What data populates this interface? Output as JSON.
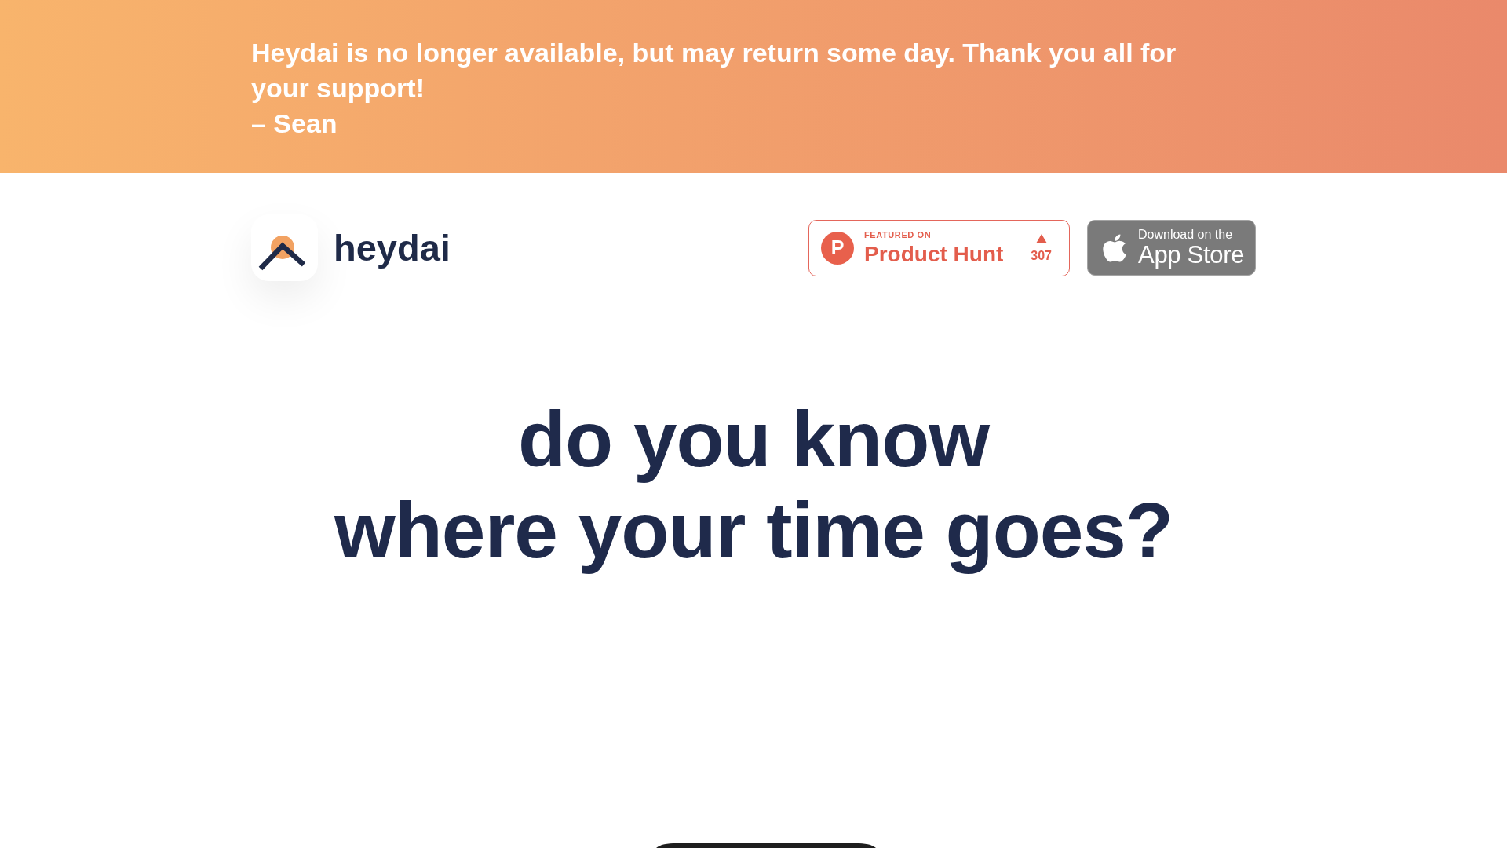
{
  "banner": {
    "message": "Heydai is no longer available, but may return some day. Thank you all for your support!",
    "signature": "– Sean"
  },
  "header": {
    "brand": "heydai",
    "badges": [
      {
        "kind": "product_hunt",
        "logo_letter": "P",
        "caption": "FEATURED ON",
        "title": "Product Hunt",
        "count": "307"
      },
      {
        "kind": "app_store",
        "caption": "Download on the",
        "title": "App Store"
      }
    ]
  },
  "hero": {
    "headline_lines": [
      "do you know",
      "where your time goes?"
    ]
  }
}
